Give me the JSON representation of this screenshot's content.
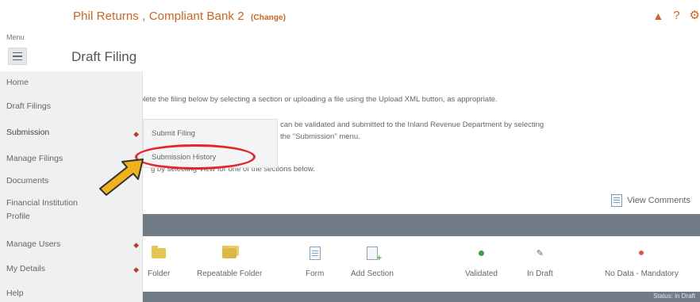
{
  "header": {
    "title": "Phil Returns , Compliant Bank 2",
    "change_label": "(Change)",
    "icons": [
      "user-icon",
      "help-icon",
      "settings-icon"
    ],
    "help_glyph": "?"
  },
  "menu": {
    "label": "Menu",
    "items": [
      {
        "label": "Home"
      },
      {
        "label": "Draft Filings"
      },
      {
        "label": "Submission"
      },
      {
        "label": "Manage Filings"
      },
      {
        "label": "Documents"
      },
      {
        "label": "Financial Institution"
      },
      {
        "label": "Profile"
      },
      {
        "label": "Manage Users"
      },
      {
        "label": "My Details"
      },
      {
        "label": "Help"
      }
    ],
    "submenu": [
      {
        "label": "Submit Filing"
      },
      {
        "label": "Submission History"
      }
    ]
  },
  "page": {
    "heading": "Draft Filing",
    "line1": "plete the filing below by selecting a section or uploading a file using the Upload XML button, as appropriate.",
    "line2": "can be validated and submitted to the Inland Revenue Department by selecting",
    "line3": "the \"Submission\" menu.",
    "line4": "g by selecting View for one of the sections below.",
    "view_comments": "View Comments"
  },
  "legend": [
    {
      "label": "Folder",
      "icon": "folder-icon"
    },
    {
      "label": "Repeatable Folder",
      "icon": "repeatable-folder-icon"
    },
    {
      "label": "Form",
      "icon": "form-icon"
    },
    {
      "label": "Add Section",
      "icon": "add-section-icon"
    },
    {
      "label": "Validated",
      "icon": "validated-dot-icon"
    },
    {
      "label": "In Draft",
      "icon": "pencil-icon"
    },
    {
      "label": "No Data - Mandatory",
      "icon": "mandatory-dot-icon"
    }
  ],
  "bottom_bar": {
    "label": "Status: in Draft"
  },
  "colors": {
    "accent": "#d9601f",
    "bar": "#727c86",
    "annotation": "#e3262b",
    "arrow": "#f2b21b"
  }
}
